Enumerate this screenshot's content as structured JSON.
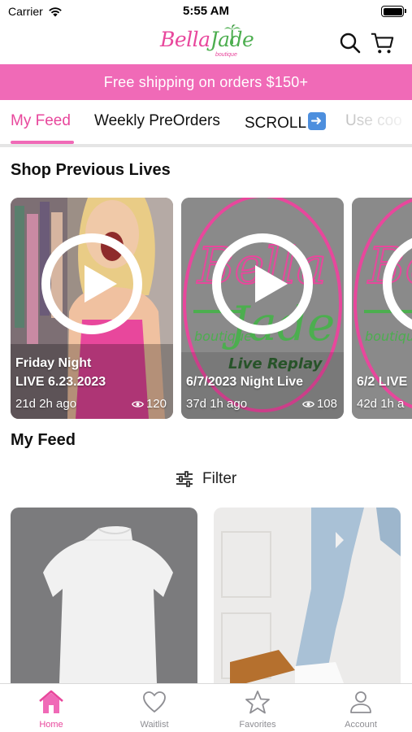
{
  "status_bar": {
    "carrier": "Carrier",
    "time": "5:55 AM"
  },
  "header": {
    "logo": {
      "text_pink": "Bella",
      "text_green": "Jade",
      "sub": "boutique"
    },
    "icons": {
      "search": "search-icon",
      "cart": "cart-icon"
    }
  },
  "promo_banner": {
    "text": "Free shipping on orders $150+"
  },
  "tabs": [
    {
      "label": "My Feed",
      "active": true
    },
    {
      "label": "Weekly PreOrders",
      "active": false
    },
    {
      "label": "SCROLL",
      "active": false
    },
    {
      "label": "Use coo",
      "active": false
    }
  ],
  "sections": {
    "previous_lives_title": "Shop Previous Lives",
    "my_feed_title": "My Feed",
    "filter_label": "Filter"
  },
  "lives": [
    {
      "title_line1": "Friday Night",
      "title_line2": "LIVE 6.23.2023",
      "ago": "21d 2h ago",
      "views": "120"
    },
    {
      "title_line1": "",
      "title_line2": "6/7/2023 Night Live",
      "ago": "37d 1h ago",
      "views": "108",
      "thumb_text": "Live Replay"
    },
    {
      "title_line1": "",
      "title_line2": "6/2 LIVE",
      "ago": "42d 1h a",
      "views": ""
    }
  ],
  "bottom_tabs": [
    {
      "label": "Home",
      "icon": "home-icon",
      "active": true
    },
    {
      "label": "Waitlist",
      "icon": "heart-icon",
      "active": false
    },
    {
      "label": "Favorites",
      "icon": "star-icon",
      "active": false
    },
    {
      "label": "Account",
      "icon": "person-icon",
      "active": false
    }
  ],
  "colors": {
    "brand_pink": "#f06ab7",
    "accent_pink": "#e8479c",
    "brand_green": "#4cae4f"
  }
}
